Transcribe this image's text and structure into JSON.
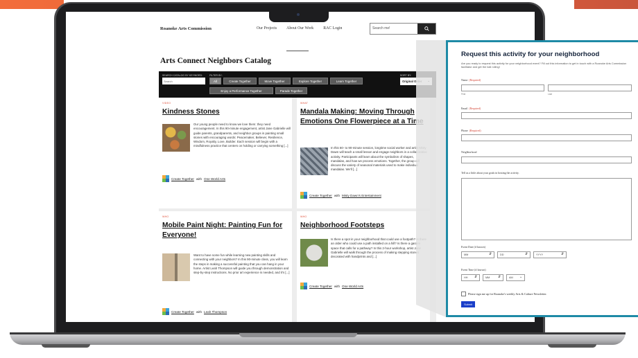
{
  "site": {
    "brand": "Roanoke Arts Commission",
    "nav": [
      "Our Projects",
      "About Our Work",
      "RAC Login"
    ],
    "search_placeholder": "Search me!",
    "search_icon": "search-icon"
  },
  "catalog": {
    "title": "Arts Connect Neighbors Catalog",
    "search_label": "SEARCH CATALOG BY KEYWORD:",
    "search_placeholder": "Search",
    "filter_label": "FILTER BY:",
    "filters": [
      "All",
      "Create Together",
      "Move Together",
      "Explore Together",
      "Learn Together",
      "Enjoy a Performance Together",
      "Parade Together"
    ],
    "active_filter": "All",
    "sort_label": "SORT BY:",
    "sort_value": "Original Order"
  },
  "cards": [
    {
      "tag": "VIDEO",
      "title": "Kindness Stones",
      "description": "Our young people need to know we love them: they need encouragement. In this 90-minute engagement, artist Jane Gabrielle will guide parents, grandparents, and neighbor groups in painting small stones with encouraging words: Peacemaker, Believer, Resilience, Wisdom, Royalty, Love, Builder. Each session will begin with a mindfulness practice that centers on holding or carrying something [...]",
      "category": "Create Together",
      "with_text": "with",
      "partner": "One World Arts"
    },
    {
      "tag": "WHAT",
      "title": "Mandala Making: Moving Through Emotions One Flowerpiece at a Time",
      "description": "In this 60- to 90-minute session, longtime social worker and artist Misty Dawn will teach a small lesson and engage neighbors in a collaborative activity. Participants will learn about the symbolism of shapes, mandalas, and how we process emotions. Together, the group will discuss the variety of seasonal materials used to make individual mandalas. We'll [...]",
      "category": "Create Together",
      "with_text": "with",
      "partner": "Misty Dawn's Entertainment"
    },
    {
      "tag": "WHO",
      "title": "Mobile Paint Night: Painting Fun for Everyone!",
      "description": "Want to have some fun while learning new painting skills and connecting with your neighbors? In this 90-minute class, you will learn the steps in making a successful painting that you can hang in your home. Artist Leah Thompson will guide you through demonstration and step-by-step instructions. No prior art experience is needed, and it's [...]",
      "category": "Create Together",
      "with_text": "with",
      "partner": "Leah Thompson"
    },
    {
      "tag": "WHO",
      "title": "Neighborhood Footsteps",
      "description": "Is there a spot in your neighborhood that could use a footpath? Is there an older who could use a path installed on a hill? Is there a garden space that calls for a pathway? In this 2-hour workshop, artist Jane Gabrielle will walk through the process of making stepping stones decorated with handprints and [...]",
      "category": "Create Together",
      "with_text": "with",
      "partner": "One World Arts"
    }
  ],
  "form": {
    "title": "Request this activity for your neighborhood",
    "intro": "Are you ready to request this activity for your neighborhood event? Fill out this information to get in touch with a Roanoke Arts Commission facilitator and get the ball rolling!",
    "name_label": "Name",
    "required_text": "(Required)",
    "first_label": "First",
    "last_label": "Last",
    "email_label": "Email",
    "phone_label": "Phone",
    "neighborhood_label": "Neighborhood",
    "goals_label": "Tell us a little about your goals in hosting the activity.",
    "date_label": "Event Date (if known)",
    "date_mm": "MM",
    "date_dd": "DD",
    "date_yyyy": "YYYY",
    "time_label": "Event Time (if known)",
    "time_hh": "HH",
    "time_mm": "MM",
    "time_ampm": "AM",
    "newsletter_label": "Please sign me up for Roanoke's weekly Arts & Culture Newsletter.",
    "submit_label": "Submit"
  },
  "colors": {
    "accent_orange": "#f26d3a",
    "form_border": "#1e8aa6",
    "submit_blue": "#1b3fc9",
    "tag_red": "#e0523c",
    "required_red": "#d23c2c"
  }
}
